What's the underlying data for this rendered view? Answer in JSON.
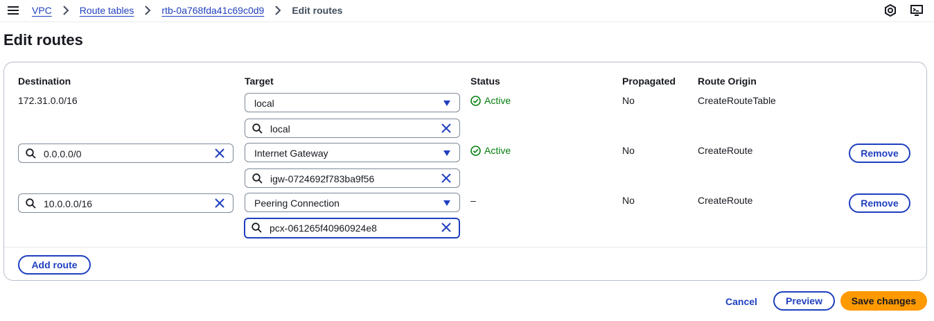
{
  "breadcrumb": {
    "items": [
      "VPC",
      "Route tables",
      "rtb-0a768fda41c69c0d9"
    ],
    "current": "Edit routes"
  },
  "page": {
    "title": "Edit routes"
  },
  "table": {
    "headers": {
      "destination": "Destination",
      "target": "Target",
      "status": "Status",
      "propagated": "Propagated",
      "route_origin": "Route Origin"
    },
    "rows": [
      {
        "destination": "172.31.0.0/16",
        "target_type": "local",
        "target_value": "local",
        "status": "Active",
        "propagated": "No",
        "route_origin": "CreateRouteTable"
      },
      {
        "destination": "0.0.0.0/0",
        "target_type": "Internet Gateway",
        "target_value": "igw-0724692f783ba9f56",
        "status": "Active",
        "propagated": "No",
        "route_origin": "CreateRoute",
        "remove_label": "Remove"
      },
      {
        "destination": "10.0.0.0/16",
        "target_type": "Peering Connection",
        "target_value": "pcx-061265f40960924e8",
        "status": "–",
        "propagated": "No",
        "route_origin": "CreateRoute",
        "remove_label": "Remove"
      }
    ]
  },
  "actions": {
    "add_route": "Add route",
    "cancel": "Cancel",
    "preview": "Preview",
    "save": "Save changes"
  },
  "colors": {
    "link": "#1f3fbf",
    "status_active": "#037f0c",
    "primary_button": "#ff9900"
  },
  "icons": {
    "menu": "menu-icon",
    "breadcrumb_separator": "chevron-right-icon",
    "top_right_1": "hexagon-settings-icon",
    "top_right_2": "cloudshell-icon",
    "search": "search-icon",
    "clear": "close-icon",
    "dropdown": "caret-down-icon",
    "status": "check-circle-icon"
  }
}
